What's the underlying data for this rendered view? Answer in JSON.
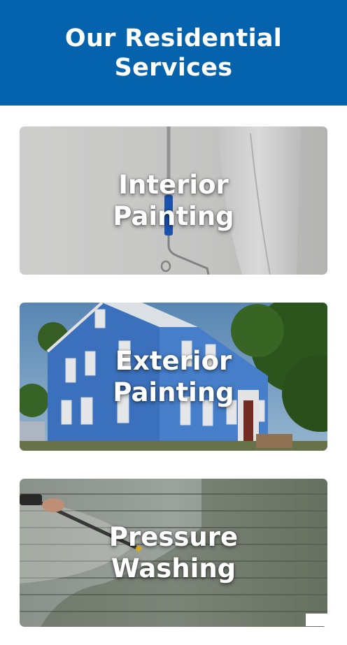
{
  "header": {
    "title": "Our Residential Services"
  },
  "services": [
    {
      "label": "Interior Painting"
    },
    {
      "label": "Exterior Painting"
    },
    {
      "label": "Pressure Washing"
    }
  ],
  "colors": {
    "header_bg": "#0563ad",
    "text": "#ffffff"
  }
}
